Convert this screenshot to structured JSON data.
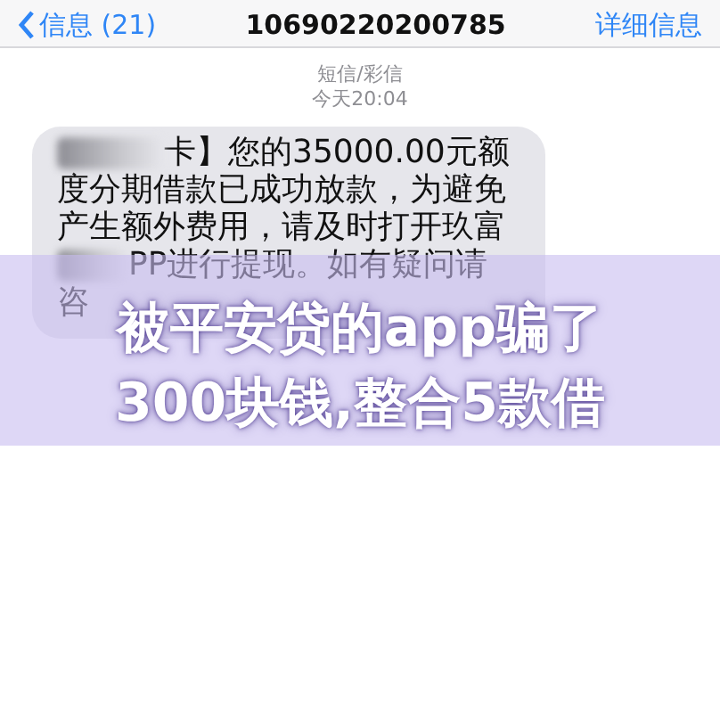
{
  "nav_bar": {
    "back": "信息 (21)",
    "title": "10690220200785",
    "action": "详细信息"
  },
  "header": {
    "service": "短信/彩信",
    "time": "今天20:04"
  },
  "message": {
    "lines": [
      {
        "redacted": true,
        "text": "卡】您的35000.00元额"
      },
      {
        "redacted": false,
        "text": "度分期借款已成功放款，为避免"
      },
      {
        "redacted": false,
        "text": "产生额外费用，请及时打开玖富"
      },
      {
        "redacted": true,
        "text": "PP进行提现。如有疑问请"
      },
      {
        "redacted": false,
        "text": "咨"
      }
    ]
  },
  "banner": {
    "lines": [
      "被平安贷的app骗了",
      "300块钱,整合5款借"
    ]
  }
}
